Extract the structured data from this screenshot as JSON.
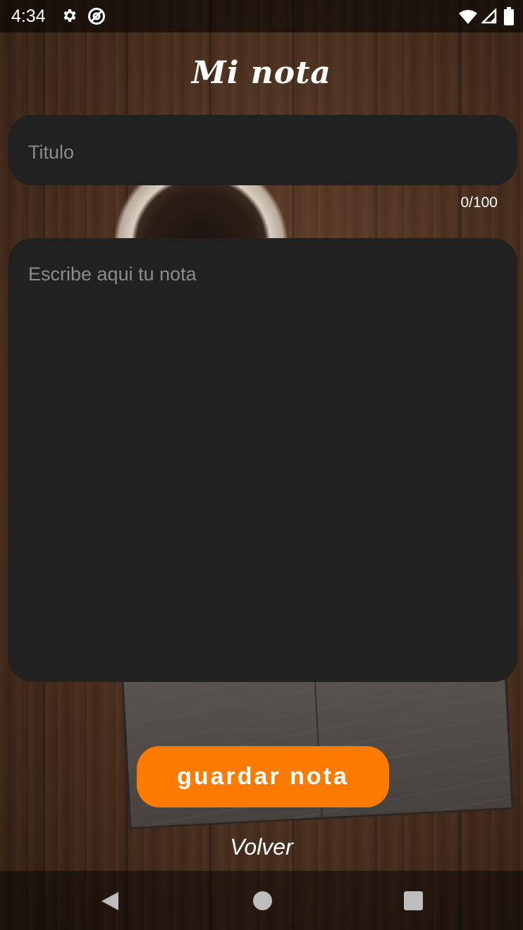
{
  "status_bar": {
    "time": "4:34",
    "icons": [
      "gear-icon",
      "at-sign-icon",
      "wifi-icon",
      "signal-icon",
      "battery-icon"
    ]
  },
  "header": {
    "title": "Mi nota"
  },
  "form": {
    "title_placeholder": "Titulo",
    "title_value": "",
    "char_counter": "0/100",
    "note_placeholder": "Escribe aqui tu nota",
    "note_value": ""
  },
  "actions": {
    "save_label": "guardar nota",
    "back_label": "Volver"
  },
  "colors": {
    "accent": "#ff7b00",
    "field_bg": "#212121",
    "placeholder": "#8c8c8c"
  },
  "nav_bar": {
    "icons": [
      "back-triangle-icon",
      "home-circle-icon",
      "recents-square-icon"
    ]
  }
}
